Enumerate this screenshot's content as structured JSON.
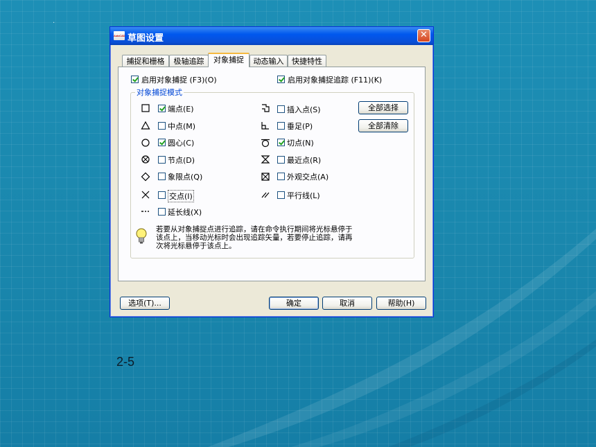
{
  "dialog": {
    "title": "草图设置",
    "app_icon_text": "AutoCAD",
    "tabs": [
      {
        "label": "捕捉和栅格"
      },
      {
        "label": "极轴追踪"
      },
      {
        "label": "对象捕捉",
        "active": true
      },
      {
        "label": "动态输入"
      },
      {
        "label": "快捷特性"
      }
    ],
    "enable_osnap": {
      "label": "启用对象捕捉 (F3)(O)",
      "checked": true
    },
    "enable_tracking": {
      "label": "启用对象捕捉追踪 (F11)(K)",
      "checked": true
    },
    "group_title": "对象捕捉模式",
    "modes_left": [
      {
        "label": "端点(E)",
        "checked": true,
        "icon": "square-marker-icon"
      },
      {
        "label": "中点(M)",
        "checked": false,
        "icon": "triangle-marker-icon"
      },
      {
        "label": "圆心(C)",
        "checked": true,
        "icon": "circle-marker-icon"
      },
      {
        "label": "节点(D)",
        "checked": false,
        "icon": "node-marker-icon"
      },
      {
        "label": "象限点(Q)",
        "checked": false,
        "icon": "diamond-marker-icon"
      },
      {
        "label": "交点(I)",
        "checked": false,
        "icon": "x-marker-icon"
      },
      {
        "label": "延长线(X)",
        "checked": false,
        "icon": "extension-marker-icon"
      }
    ],
    "modes_right": [
      {
        "label": "插入点(S)",
        "checked": false,
        "icon": "insert-marker-icon"
      },
      {
        "label": "垂足(P)",
        "checked": false,
        "icon": "perpendicular-marker-icon"
      },
      {
        "label": "切点(N)",
        "checked": true,
        "icon": "tangent-marker-icon"
      },
      {
        "label": "最近点(R)",
        "checked": false,
        "icon": "nearest-marker-icon"
      },
      {
        "label": "外观交点(A)",
        "checked": false,
        "icon": "apparent-marker-icon"
      },
      {
        "label": "平行线(L)",
        "checked": false,
        "icon": "parallel-marker-icon"
      }
    ],
    "select_all_label": "全部选择",
    "clear_all_label": "全部清除",
    "hint_lines": [
      "若要从对象捕捉点进行追踪，请在命令执行期间将光标悬停于",
      "该点上，当移动光标时会出现追踪矢量，若要停止追踪，请再",
      "次将光标悬停于该点上。"
    ],
    "options_label": "选项(T)...",
    "ok_label": "确定",
    "cancel_label": "取消",
    "help_label": "帮助(H)"
  },
  "slide": {
    "dot": "·",
    "caption": "2-5"
  },
  "colors": {
    "background": "#1a87ad",
    "titlebar": "#0058ee",
    "dialog_face": "#ece9d8",
    "group_title": "#0046d5",
    "check_mark": "#21a121"
  }
}
